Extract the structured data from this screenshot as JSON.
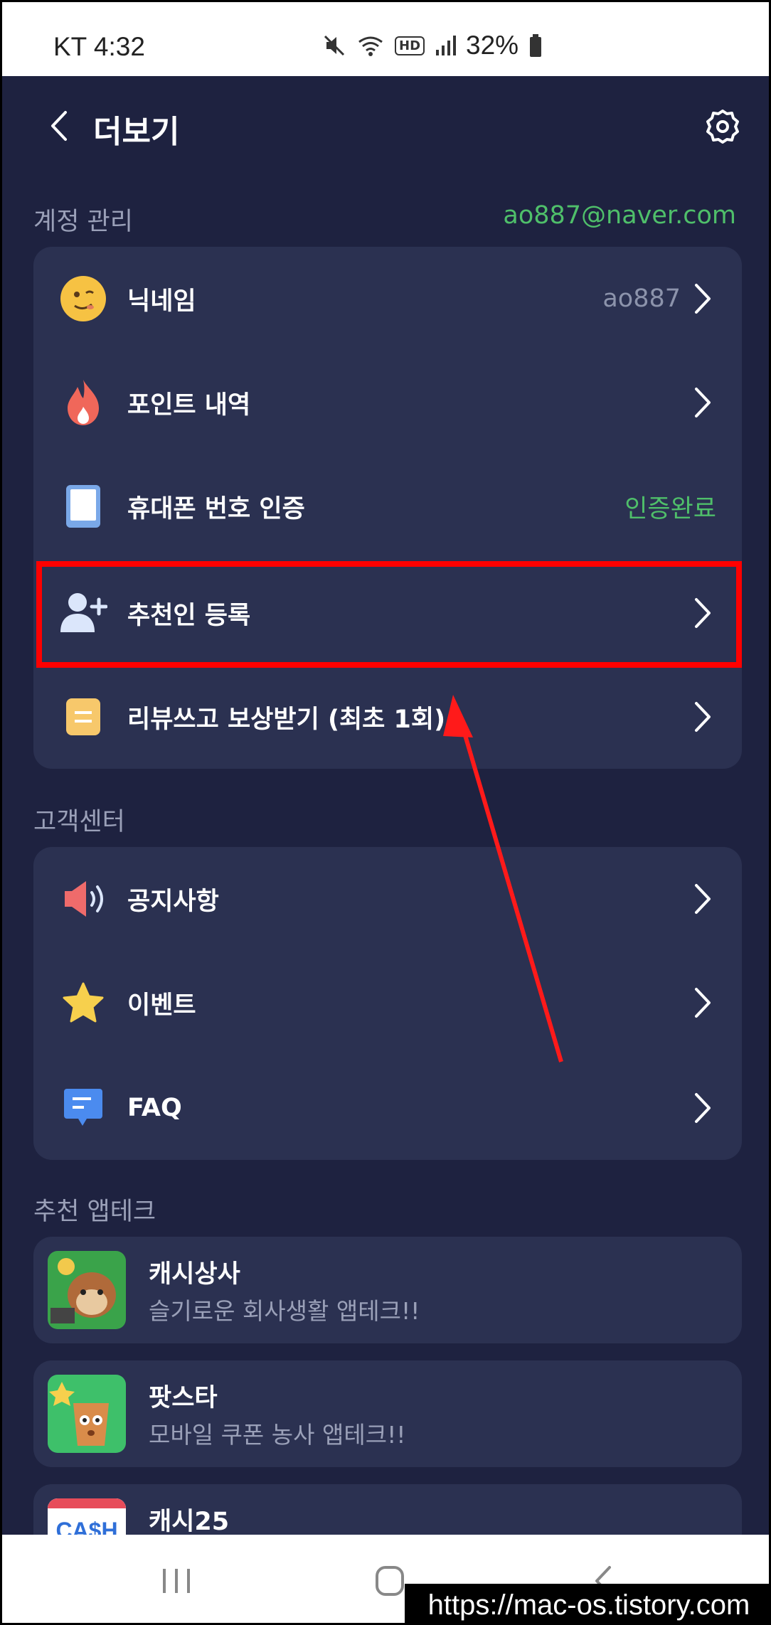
{
  "status_bar": {
    "carrier_time": "KT 4:32",
    "hd_badge": "HD",
    "battery_pct": "32%"
  },
  "header": {
    "title": "더보기"
  },
  "account": {
    "section_label": "계정 관리",
    "email": "ao887@naver.com",
    "rows": [
      {
        "label": "닉네임",
        "value": "ao887",
        "icon": "smiley-icon"
      },
      {
        "label": "포인트 내역",
        "value": "",
        "icon": "flame-icon"
      },
      {
        "label": "휴대폰 번호 인증",
        "value": "인증완료",
        "icon": "phone-icon"
      },
      {
        "label": "추천인 등록",
        "value": "",
        "icon": "add-user-icon"
      },
      {
        "label": "리뷰쓰고 보상받기 (최초 1회)",
        "value": "",
        "icon": "note-icon"
      }
    ]
  },
  "support": {
    "section_label": "고객센터",
    "rows": [
      {
        "label": "공지사항",
        "icon": "megaphone-icon"
      },
      {
        "label": "이벤트",
        "icon": "star-icon"
      },
      {
        "label": "FAQ",
        "icon": "chat-icon"
      }
    ]
  },
  "apptech": {
    "section_label": "추천 앱테크",
    "apps": [
      {
        "name": "캐시상사",
        "desc": "슬기로운 회사생활 앱테크!!"
      },
      {
        "name": "팟스타",
        "desc": "모바일 쿠폰 농사 앱테크!!"
      },
      {
        "name": "캐시25",
        "desc": "",
        "thumb_text": "CA$H"
      }
    ]
  },
  "watermark": "https://mac-os.tistory.com",
  "colors": {
    "background": "#1e2240",
    "card": "#2b3151",
    "green": "#4fbf6a",
    "highlight": "#ff0000"
  }
}
